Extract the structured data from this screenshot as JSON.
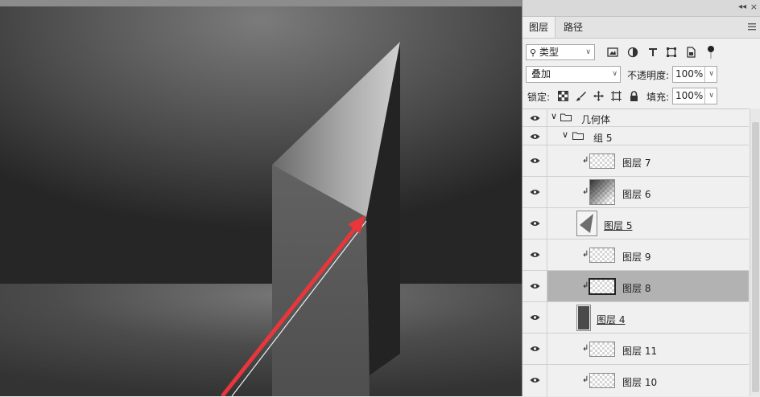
{
  "panel": {
    "tabs": [
      {
        "label": "图层",
        "active": true
      },
      {
        "label": "路径",
        "active": false
      }
    ],
    "filter": {
      "label": "类型"
    },
    "blend_mode": "叠加",
    "opacity_label": "不透明度:",
    "opacity_value": "100%",
    "lock_label": "锁定:",
    "fill_label": "填充:",
    "fill_value": "100%",
    "layers": [
      {
        "name": "几何体",
        "type": "group",
        "expanded": true
      },
      {
        "name": "组 5",
        "type": "group",
        "expanded": true
      },
      {
        "name": "图层 7",
        "type": "layer",
        "clipped": true,
        "thumbnail": "transparent"
      },
      {
        "name": "图层 6",
        "type": "layer",
        "clipped": true,
        "thumbnail": "gradient"
      },
      {
        "name": "图层 5",
        "type": "layer",
        "clipped": false,
        "thumbnail": "triangle",
        "underlined": true
      },
      {
        "name": "图层 9",
        "type": "layer",
        "clipped": true,
        "thumbnail": "transparent"
      },
      {
        "name": "图层 8",
        "type": "layer",
        "clipped": true,
        "thumbnail": "transparent",
        "selected": true
      },
      {
        "name": "图层 4",
        "type": "layer",
        "clipped": false,
        "thumbnail": "dark-shape",
        "underlined": true
      },
      {
        "name": "图层 11",
        "type": "layer",
        "clipped": true,
        "thumbnail": "transparent"
      },
      {
        "name": "图层 10",
        "type": "layer",
        "clipped": true,
        "thumbnail": "transparent"
      }
    ],
    "icons": {
      "collapse": "collapse-icon",
      "close": "close-icon",
      "menu": "panel-menu-icon",
      "filters": [
        "image-filter-icon",
        "adjustment-filter-icon",
        "type-filter-icon",
        "shape-filter-icon",
        "smart-object-filter-icon",
        "filter-toggle-icon"
      ],
      "locks": [
        "lock-transparent-icon",
        "lock-paint-icon",
        "lock-position-icon",
        "lock-artboard-icon",
        "lock-all-icon"
      ],
      "visibility": "eye-icon",
      "clip": "clipping-mask-icon",
      "folder": "folder-icon"
    }
  },
  "colors": {
    "arrow": "#e8363b",
    "selected_row": "#b2b2b2",
    "panel_bg": "#f0f0f0"
  }
}
